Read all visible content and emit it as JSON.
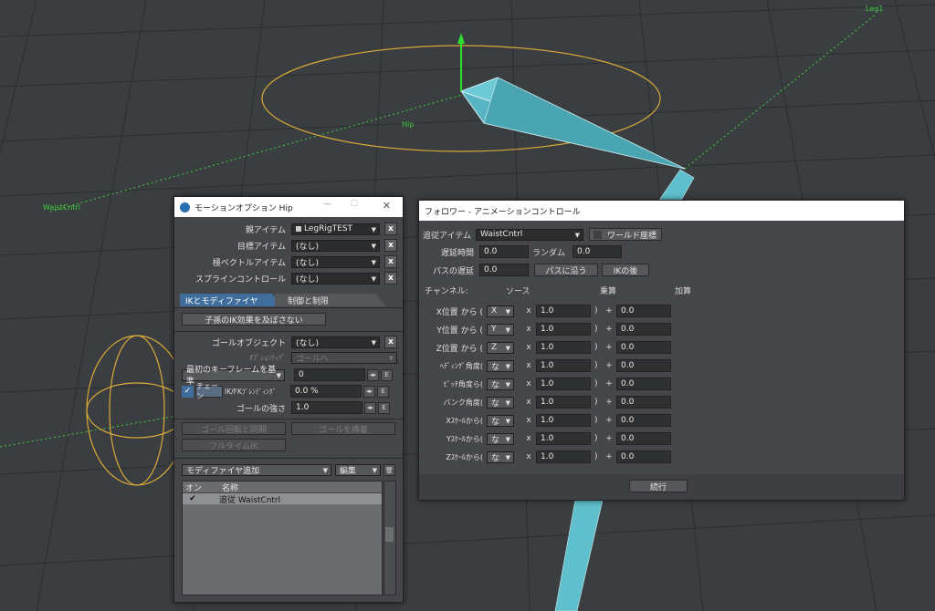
{
  "viewport": {
    "labels": {
      "leg": "Leg1",
      "hip": "Hip",
      "waist": "WaistCntrl"
    }
  },
  "motion": {
    "title": "モーションオプション Hip",
    "rows": [
      {
        "label": "親アイテム",
        "value": "LegRigTEST"
      },
      {
        "label": "目標アイテム",
        "value": "(なし)"
      },
      {
        "label": "極ベクトルアイテム",
        "value": "(なし)"
      },
      {
        "label": "スプラインコントロール",
        "value": "(なし)"
      }
    ],
    "tabs": [
      "IKとモディファイヤ",
      "制御と制限"
    ],
    "child_ik_button": "子孫のIK効果を及ぼさない",
    "goal_object": {
      "label": "ゴールオブジェクト",
      "value": "(なし)"
    },
    "option_label": "ｵﾌﾟｼｮﾝﾃｨｸﾞ",
    "option_value": "ゴールへ",
    "first_key_dropdown": "最初のキーフレームを基準",
    "first_key_value": "0",
    "chain_button": "チェーン",
    "blend_label": "IK/FKﾌﾞﾚﾝﾃﾞｨﾝｸﾞ",
    "blend_value": "0.0 %",
    "goal_strength_label": "ゴールの強さ",
    "goal_strength_value": "1.0",
    "sync_button": "ゴール回転と同期",
    "insert_button": "ゴールを挿着",
    "fulltime_button": "フルタイムIK",
    "add_modifier": "モディファイヤ追加",
    "edit": "編集",
    "list_headers": [
      "オン",
      "名称"
    ],
    "list_items": [
      {
        "on": "✔",
        "name": "追従  WaistCntrl"
      }
    ]
  },
  "follower": {
    "title": "フォロワー - アニメーションコントロール",
    "follow_label": "追従アイテム",
    "follow_value": "WaistCntrl",
    "world_coord": "ワールド座標",
    "delay_label": "遅延時間",
    "delay_value": "0.0",
    "random_label": "ランダム",
    "random_value": "0.0",
    "path_delay_label": "パスの遅延",
    "path_delay_value": "0.0",
    "along_path": "パスに沿う",
    "ik_after": "IKの後",
    "channel_header": "チャンネル:",
    "source_header": "ソース",
    "mult_header": "乗算",
    "add_header": "加算",
    "channels": [
      {
        "label": "X位置 から (",
        "src": "X",
        "mult": "1.0",
        "add": "0.0",
        "active": true
      },
      {
        "label": "Y位置 から (",
        "src": "Y",
        "mult": "1.0",
        "add": "0.0",
        "active": true
      },
      {
        "label": "Z位置 から (",
        "src": "Z",
        "mult": "1.0",
        "add": "0.0",
        "active": true
      },
      {
        "label": "ﾍﾃﾞｨﾝｸﾞ角度(",
        "src": "な",
        "mult": "1.0",
        "add": "0.0",
        "active": false
      },
      {
        "label": "ﾋﾟｯﾁ角度ら(",
        "src": "な",
        "mult": "1.0",
        "add": "0.0",
        "active": false
      },
      {
        "label": "バンク角度(",
        "src": "な",
        "mult": "1.0",
        "add": "0.0",
        "active": false
      },
      {
        "label": "Xｽｹｰﾙから(",
        "src": "な",
        "mult": "1.0",
        "add": "0.0",
        "active": false
      },
      {
        "label": "Yｽｹｰﾙから(",
        "src": "な",
        "mult": "1.0",
        "add": "0.0",
        "active": false
      },
      {
        "label": "Zｽｹｰﾙから(",
        "src": "な",
        "mult": "1.0",
        "add": "0.0",
        "active": false
      }
    ],
    "x_sym": "x",
    "close_paren": ")",
    "plus_sym": "+",
    "continue": "続行"
  }
}
